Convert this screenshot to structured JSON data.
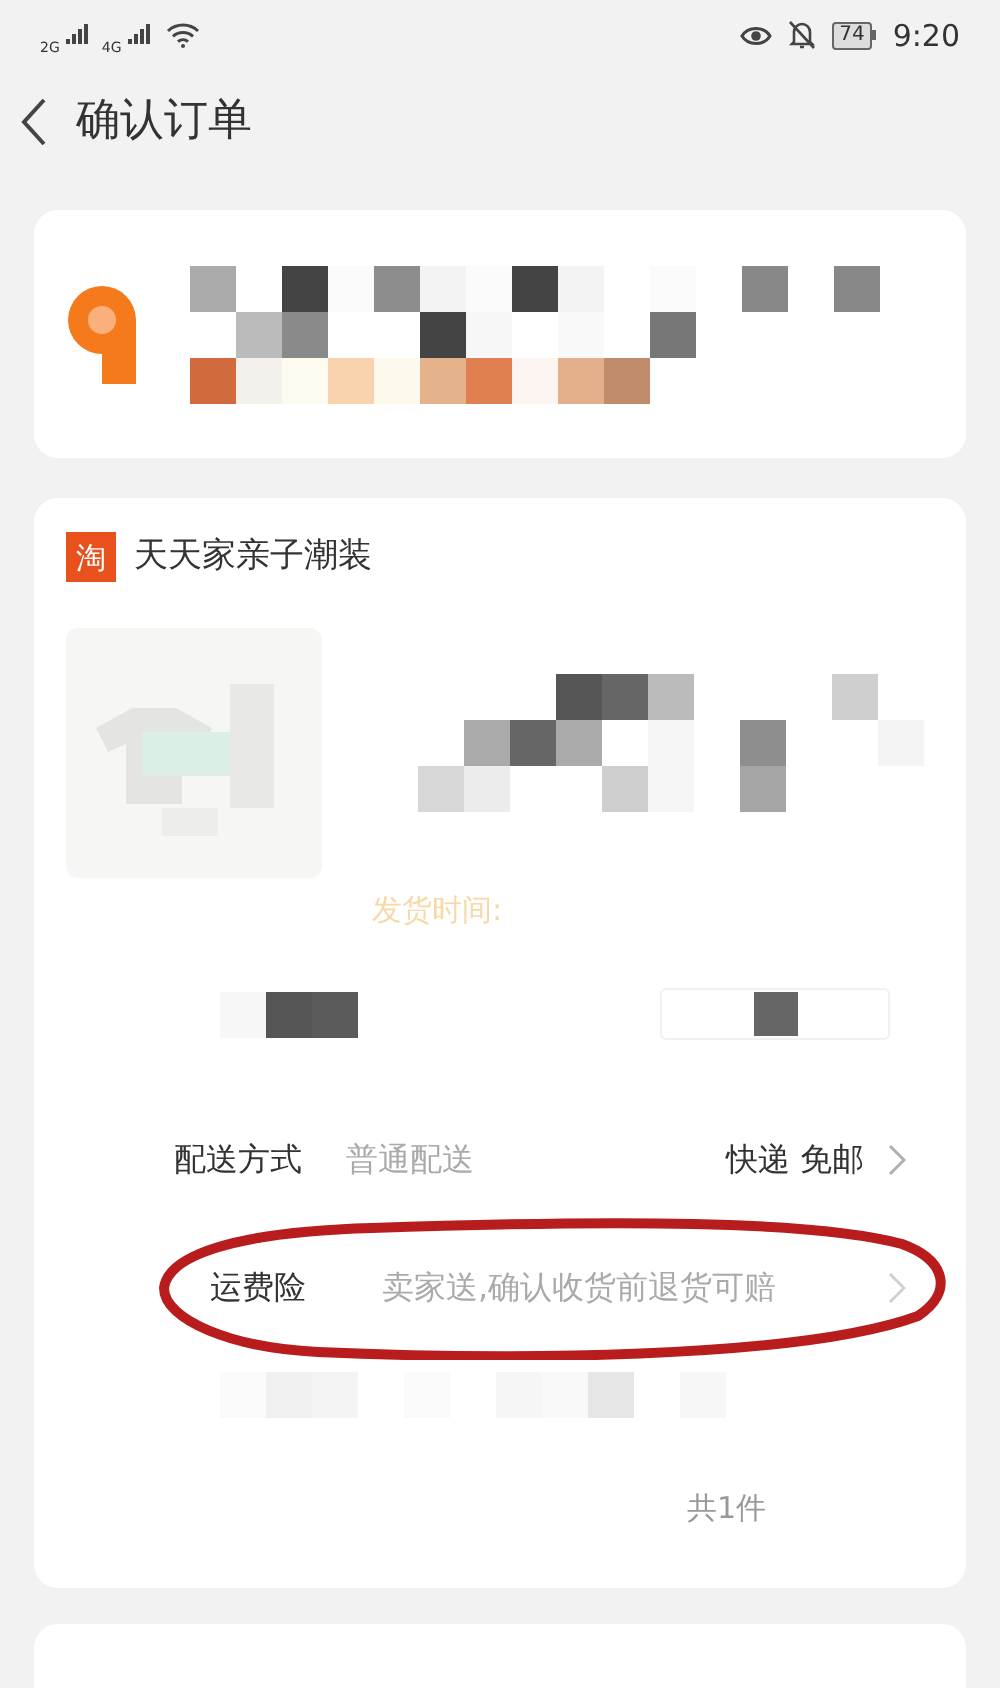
{
  "status_bar": {
    "network_1": "2G",
    "network_2": "4G",
    "battery": "74",
    "time": "9:20"
  },
  "header": {
    "title": "确认订单"
  },
  "shop": {
    "badge": "淘",
    "name": "天天家亲子潮装"
  },
  "product": {
    "ship_time": "发货时间:"
  },
  "order_rows": [
    {
      "label": "配送方式",
      "value": "普通配送",
      "detail": "快递 免邮",
      "circled": false
    },
    {
      "label": "运费险",
      "value": "卖家送,确认收货前退货可赔",
      "circled": true
    }
  ],
  "summary": "共1件"
}
